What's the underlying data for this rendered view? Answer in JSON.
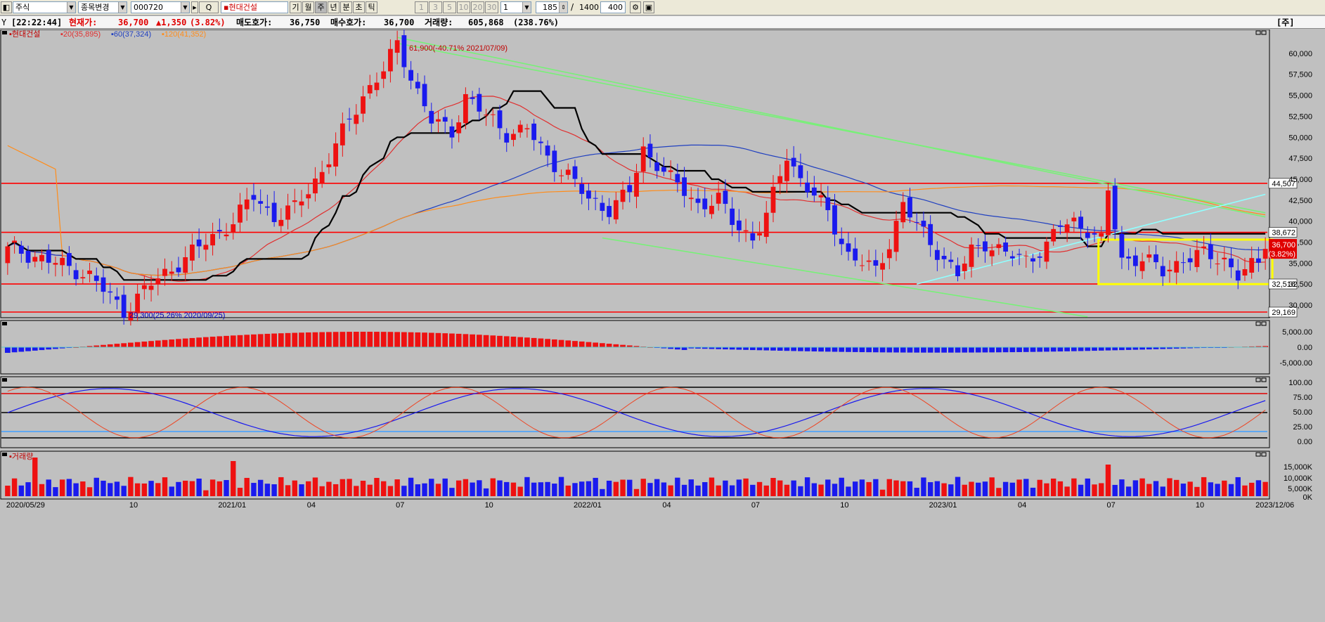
{
  "toolbar": {
    "market": "주식",
    "mode": "종목변경",
    "code": "000720",
    "name": "▪현대건설",
    "periods": [
      "기",
      "월",
      "주",
      "년",
      "분",
      "초",
      "틱"
    ],
    "active_period": "주",
    "intervals": [
      "1",
      "3",
      "5",
      "10",
      "20",
      "30"
    ],
    "interval_value": "1",
    "count": "185",
    "total": "1400",
    "view": "400",
    "corner_tag": "[주]"
  },
  "info": {
    "time": "[22:22:44]",
    "price_label": "현재가:",
    "price": "36,700",
    "change": "▲1,350",
    "change_pct": "(3.82%)",
    "ask_label": "매도호가:",
    "ask": "36,750",
    "bid_label": "매수호가:",
    "bid": "36,700",
    "volume_label": "거래량:",
    "volume": "605,868",
    "volume_pct": "(238.76%)"
  },
  "legend": {
    "name": "▪현대건설",
    "ma20": "▪20(35,895)",
    "ma60": "▪60(37,324)",
    "ma120": "▪120(41,352)",
    "volume_title": "▪거래량"
  },
  "annotations": {
    "high": "61,900(-40.71% 2021/07/09)",
    "low": "29,300(25.26% 2020/09/25)"
  },
  "price_tags": [
    "44,507",
    "38,672",
    "32,518",
    "29,169"
  ],
  "current_tag": {
    "price": "36,700",
    "pct": "(3.82%)"
  },
  "colors": {
    "up": "#ee1111",
    "down": "#1a1aee",
    "bg": "#c0c0c0",
    "ma20": "#e03030",
    "ma60": "#2040c0",
    "ma120": "#ff8c1a",
    "ichimoku": "#000000",
    "trend_green": "#78f078",
    "trend_cyan": "#90ffff",
    "box": "#ffff00",
    "hline": "#ff0000"
  },
  "chart_data": {
    "type": "candlestick",
    "frequency": "weekly",
    "x_ticks": [
      "2020/05/29",
      "10",
      "2021/01",
      "04",
      "07",
      "10",
      "2022/01",
      "04",
      "07",
      "10",
      "2023/01",
      "04",
      "07",
      "10",
      "2023/12/06"
    ],
    "y_ticks": [
      "60,000",
      "57,500",
      "55,000",
      "52,500",
      "50,000",
      "47,500",
      "45,000",
      "42,500",
      "40,000",
      "37,500",
      "35,000",
      "32,500",
      "30,000"
    ],
    "ylim": [
      28500,
      62500
    ],
    "horizontal_lines": [
      44507,
      38672,
      32518,
      29169
    ],
    "close_anchors": [
      [
        0,
        37000
      ],
      [
        5,
        35500
      ],
      [
        9,
        34500
      ],
      [
        12,
        33500
      ],
      [
        17,
        29300
      ],
      [
        21,
        32500
      ],
      [
        25,
        35000
      ],
      [
        29,
        37500
      ],
      [
        33,
        40000
      ],
      [
        36,
        43000
      ],
      [
        39,
        40500
      ],
      [
        42,
        41500
      ],
      [
        46,
        46000
      ],
      [
        49,
        50500
      ],
      [
        52,
        55000
      ],
      [
        55,
        58000
      ],
      [
        57,
        61000
      ],
      [
        60,
        55500
      ],
      [
        62,
        52000
      ],
      [
        65,
        50500
      ],
      [
        67,
        55000
      ],
      [
        70,
        52500
      ],
      [
        73,
        50500
      ],
      [
        76,
        51000
      ],
      [
        79,
        47500
      ],
      [
        82,
        45500
      ],
      [
        85,
        42500
      ],
      [
        88,
        41500
      ],
      [
        91,
        43500
      ],
      [
        93,
        48500
      ],
      [
        95,
        47000
      ],
      [
        97,
        45000
      ],
      [
        99,
        43500
      ],
      [
        101,
        42000
      ],
      [
        104,
        42500
      ],
      [
        106,
        40000
      ],
      [
        109,
        38000
      ],
      [
        111,
        40500
      ],
      [
        114,
        48000
      ],
      [
        116,
        45000
      ],
      [
        118,
        43000
      ],
      [
        120,
        41000
      ],
      [
        123,
        36000
      ],
      [
        125,
        35000
      ],
      [
        127,
        34000
      ],
      [
        129,
        37500
      ],
      [
        131,
        42000
      ],
      [
        133,
        39500
      ],
      [
        135,
        37500
      ],
      [
        137,
        35500
      ],
      [
        139,
        33500
      ],
      [
        141,
        36500
      ],
      [
        143,
        37500
      ],
      [
        146,
        36000
      ],
      [
        149,
        35500
      ],
      [
        152,
        37000
      ],
      [
        154,
        39500
      ],
      [
        156,
        40000
      ],
      [
        158,
        39000
      ],
      [
        160,
        37500
      ],
      [
        161,
        43500
      ],
      [
        163,
        35500
      ],
      [
        166,
        35500
      ],
      [
        169,
        34000
      ],
      [
        172,
        35500
      ],
      [
        175,
        36000
      ],
      [
        178,
        35500
      ],
      [
        180,
        33500
      ],
      [
        183,
        35000
      ],
      [
        184,
        36700
      ]
    ],
    "overlays": [
      "MA20",
      "MA60",
      "MA120",
      "Ichimoku base",
      "trend lines",
      "horizontal levels"
    ],
    "volume_ticks": [
      "15,000K",
      "10,000K",
      "5,000K",
      "0K"
    ],
    "macd_ticks": [
      "5,000.00",
      "0.00",
      "-5,000.00"
    ],
    "stoch_ticks": [
      "100.00",
      "75.00",
      "50.00",
      "25.00",
      "0.00"
    ]
  }
}
